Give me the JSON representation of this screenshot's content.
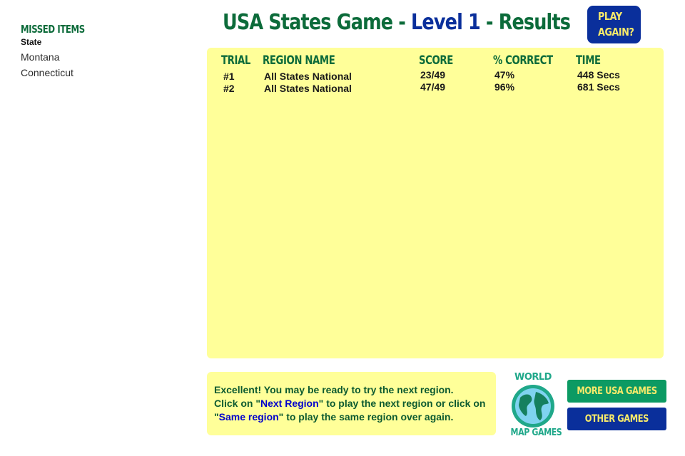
{
  "missed": {
    "title": "Missed Items",
    "column": "State",
    "items": [
      "Montana",
      "Connecticut"
    ]
  },
  "header": {
    "title_part1": "USA States Game - ",
    "title_part2": "Level 1",
    "title_part3": " - Results",
    "play_again_line1": "Play",
    "play_again_line2": "Again?"
  },
  "results": {
    "columns": [
      "Trial",
      "Region Name",
      "Score",
      "% Correct",
      "Time"
    ],
    "rows": [
      {
        "trial": "#1",
        "region": "All States National",
        "score": "23/49",
        "pct": "47%",
        "time": "448 Secs"
      },
      {
        "trial": "#2",
        "region": "All States National",
        "score": "47/49",
        "pct": "96%",
        "time": "681 Secs"
      }
    ]
  },
  "message": {
    "line1": "Excellent! You may be ready to try the next region.",
    "pre_next": "Click on \"",
    "next_link": "Next Region",
    "mid": "\" to play the next region or click on \"",
    "same_link": "Same region",
    "post": "\" to play the same region over again."
  },
  "logo": {
    "top": "World",
    "bottom": "Map Games"
  },
  "buttons": {
    "more_usa": "More USA Games",
    "other": "Other Games"
  },
  "colors": {
    "green": "#0c6b3a",
    "blue": "#0a2f9b",
    "panel": "#ffff99",
    "accent_yellow": "#f6e96a"
  }
}
